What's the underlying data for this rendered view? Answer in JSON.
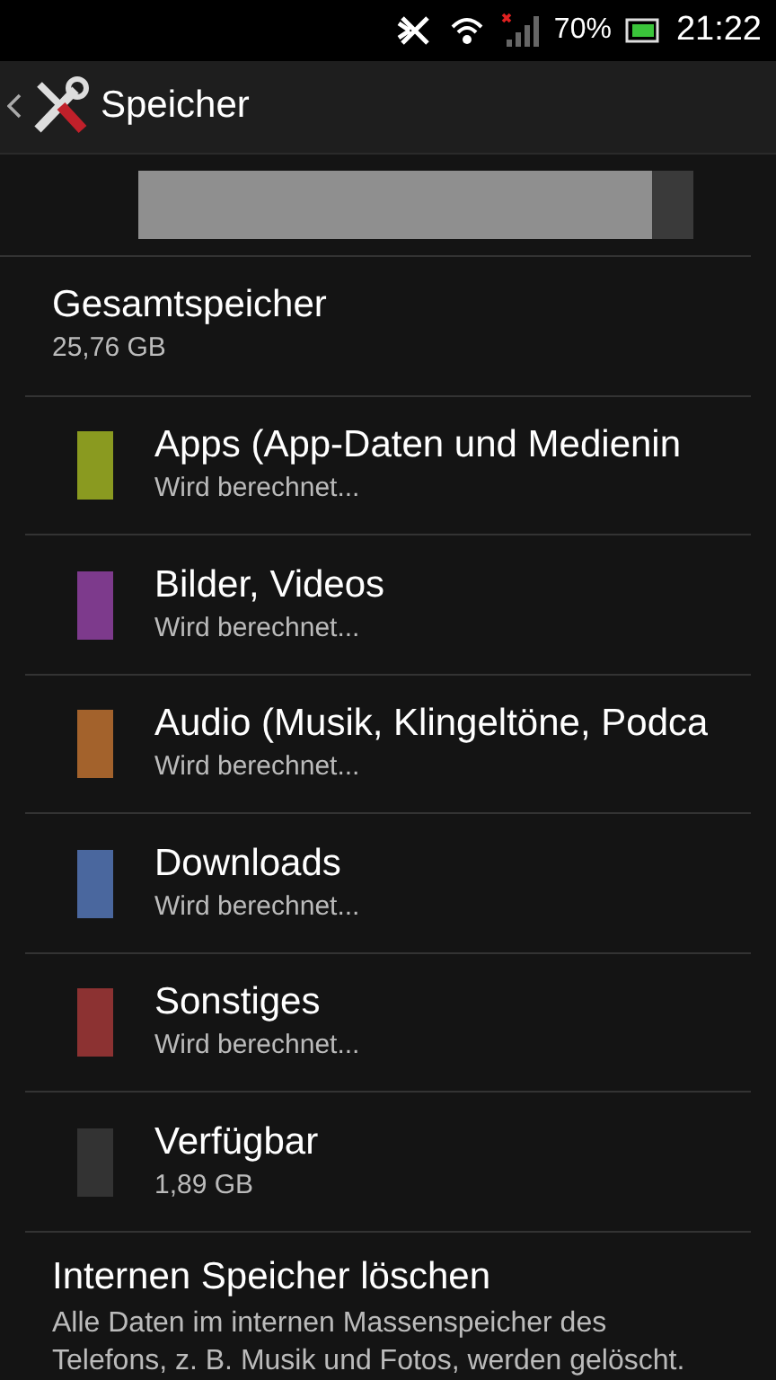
{
  "status_bar": {
    "battery": "70%",
    "time": "21:22"
  },
  "header": {
    "title": "Speicher"
  },
  "storage_bar": {
    "level": 0.926
  },
  "total": {
    "label": "Gesamtspeicher",
    "value": "25,76 GB"
  },
  "categories": [
    {
      "name": "Apps (App-Daten und Medienin",
      "value": "Wird berechnet...",
      "color": "#8a9a20"
    },
    {
      "name": "Bilder, Videos",
      "value": "Wird berechnet...",
      "color": "#7d3a8c"
    },
    {
      "name": "Audio (Musik, Klingeltöne, Podca",
      "value": "Wird berechnet...",
      "color": "#a3622c"
    },
    {
      "name": "Downloads",
      "value": "Wird berechnet...",
      "color": "#4a679e"
    },
    {
      "name": "Sonstiges",
      "value": "Wird berechnet...",
      "color": "#8c3232"
    },
    {
      "name": "Verfügbar",
      "value": "1,89 GB",
      "color": "#333333"
    }
  ],
  "erase": {
    "title": "Internen Speicher löschen",
    "description": "Alle Daten im internen Massenspeicher des Telefons, z. B. Musik und Fotos, werden gelöscht."
  }
}
